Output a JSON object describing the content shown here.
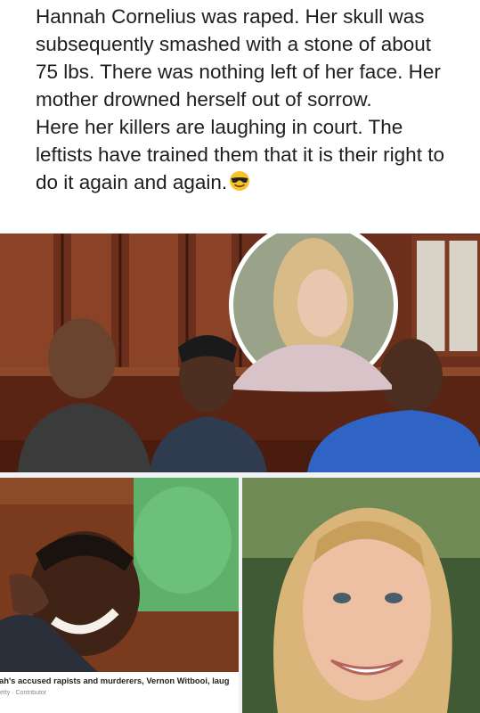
{
  "post": {
    "paragraph1": "Hannah Cornelius was raped. Her skull was subsequently smashed with a stone of about 75 lbs. There was nothing left of her face. Her mother drowned herself out of sorrow.",
    "paragraph2": "Here her killers are laughing in court. The leftists have trained them that it is their right to do it again and again.",
    "emoji": "smiling-face-with-sunglasses-icon"
  },
  "photos": {
    "court": {
      "description_icon": "courtroom-photo"
    },
    "laugh": {
      "caption": "ah's accused rapists and murderers, Vernon Witbooi, laug",
      "credit": "etty · Contributor"
    },
    "portrait": {
      "description_icon": "portrait-photo"
    }
  },
  "colors": {
    "text": "#1c1e21",
    "wood": "#7a3a22",
    "background": "#f0f2f5"
  }
}
